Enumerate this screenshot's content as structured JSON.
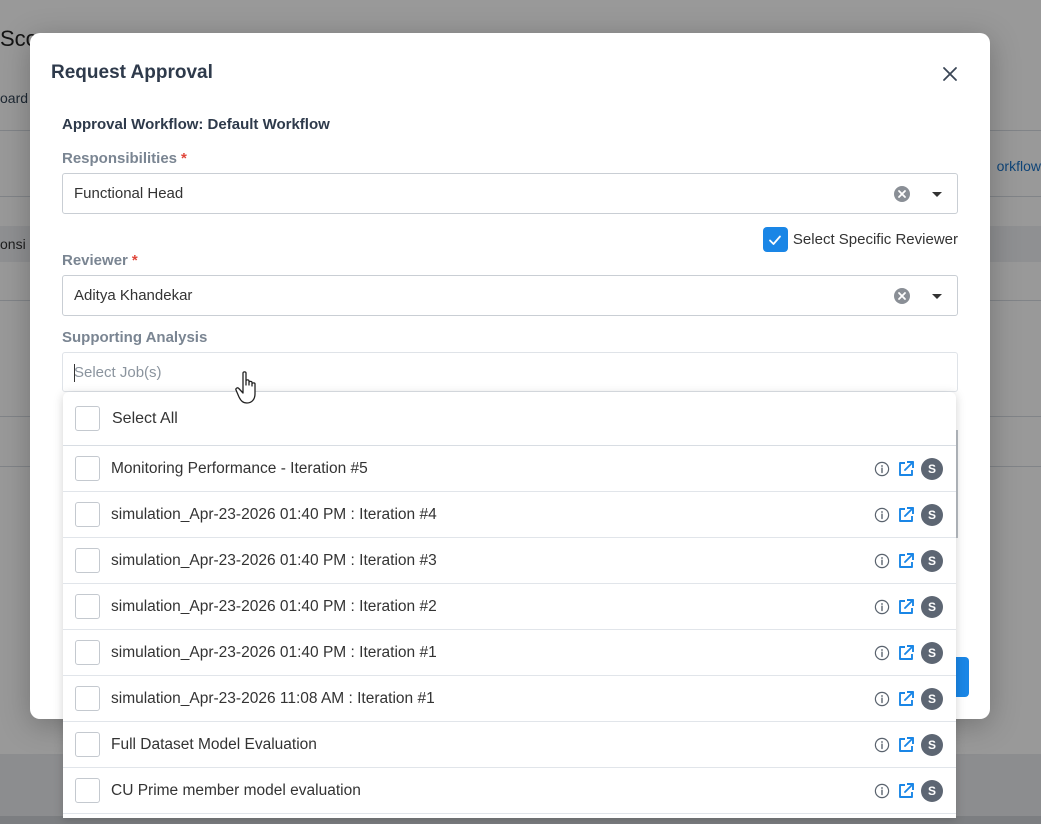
{
  "background": {
    "title": "Sco",
    "crumb": "oard",
    "link": "orkflow",
    "column": "onsi"
  },
  "modal": {
    "title": "Request Approval",
    "workflow_label": "Approval Workflow: Default Workflow",
    "responsibilities": {
      "label": "Responsibilities",
      "required_mark": "*",
      "value": "Functional Head"
    },
    "specific_reviewer": {
      "label": "Select Specific Reviewer",
      "checked": true
    },
    "reviewer": {
      "label": "Reviewer",
      "required_mark": "*",
      "value": "Aditya Khandekar"
    },
    "supporting_analysis": {
      "label": "Supporting Analysis",
      "placeholder": "Select Job(s)"
    }
  },
  "dropdown": {
    "select_all_label": "Select All",
    "badge_letter": "S",
    "items": [
      {
        "label": "Monitoring Performance - Iteration #5"
      },
      {
        "label": "simulation_Apr-23-2026 01:40 PM : Iteration #4"
      },
      {
        "label": "simulation_Apr-23-2026 01:40 PM : Iteration #3"
      },
      {
        "label": "simulation_Apr-23-2026 01:40 PM : Iteration #2"
      },
      {
        "label": "simulation_Apr-23-2026 01:40 PM : Iteration #1"
      },
      {
        "label": "simulation_Apr-23-2026 11:08 AM : Iteration #1"
      },
      {
        "label": "Full Dataset Model Evaluation"
      },
      {
        "label": "CU Prime member model evaluation"
      }
    ]
  },
  "colors": {
    "accent": "#1a86e6",
    "required": "#e0463a",
    "badge": "#5d6673"
  }
}
